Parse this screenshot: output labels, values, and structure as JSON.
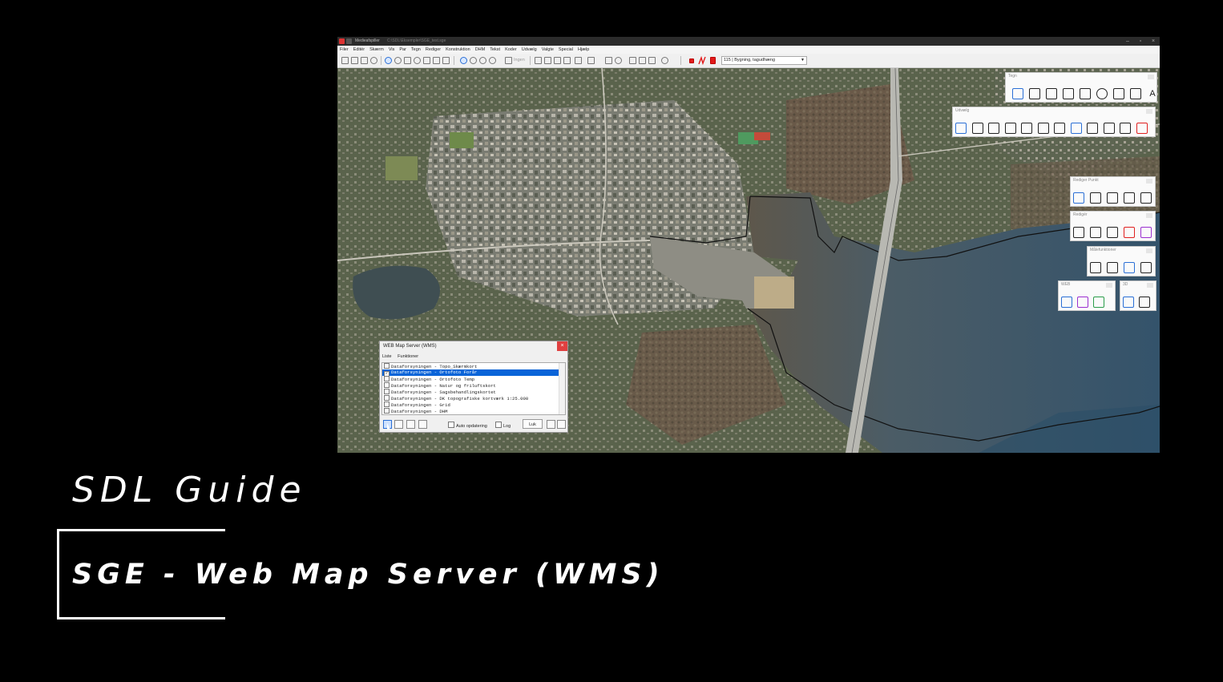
{
  "app": {
    "title": "Medieafspiller",
    "path": "C:\\SDL\\Eksempler\\SGE_test.sge",
    "menu": [
      "Filer",
      "Editér",
      "Skærm",
      "Vis",
      "Par",
      "Tegn",
      "Rediger",
      "Konstruktion",
      "DHM",
      "Tekst",
      "Koder",
      "Udvælg",
      "Valgte",
      "Special",
      "Hjælp"
    ],
    "toolbar_ingen_label": "Ingen",
    "layer_select_value": "115 | Bygning, tagudhæng"
  },
  "palettes": {
    "tegn": "Tegn",
    "udvaelg": "Udvælg",
    "rediger_punkt": "Rediger Punkt",
    "rediger": "Redigér",
    "maalefunktioner": "Målefunktioner",
    "web": "WEB",
    "three_d": "3D"
  },
  "wms_dialog": {
    "title": "WEB Map Server (WMS)",
    "close": "×",
    "menu": [
      "Liste",
      "Funktioner"
    ],
    "items": [
      {
        "label": "Dataforsyningen - Topo_Skærmkort",
        "checked": false,
        "selected": false
      },
      {
        "label": "Dataforsyningen - Ortofoto Forår",
        "checked": true,
        "selected": true
      },
      {
        "label": "Dataforsyningen - Ortofoto Temp",
        "checked": false,
        "selected": false
      },
      {
        "label": "Dataforsyningen - Natur og friluftskort",
        "checked": false,
        "selected": false
      },
      {
        "label": "Dataforsyningen - Sagsbehandlingskortet",
        "checked": false,
        "selected": false
      },
      {
        "label": "Dataforsyningen - DK topografiske kortværk 1:25.000",
        "checked": false,
        "selected": false
      },
      {
        "label": "Dataforsyningen - Grid",
        "checked": false,
        "selected": false
      },
      {
        "label": "Dataforsyningen - DHM",
        "checked": false,
        "selected": false
      }
    ],
    "auto_update_label": "Auto opdatering",
    "log_label": "Log",
    "close_button": "Luk"
  },
  "overlay": {
    "guide_title": "SDL Guide",
    "subtitle": "SGE - Web Map Server (WMS)"
  },
  "colors": {
    "background": "#000000",
    "selection": "#0a64d8",
    "close_red": "#e04040",
    "water": "#3d5c73",
    "land": "#6f7565"
  }
}
